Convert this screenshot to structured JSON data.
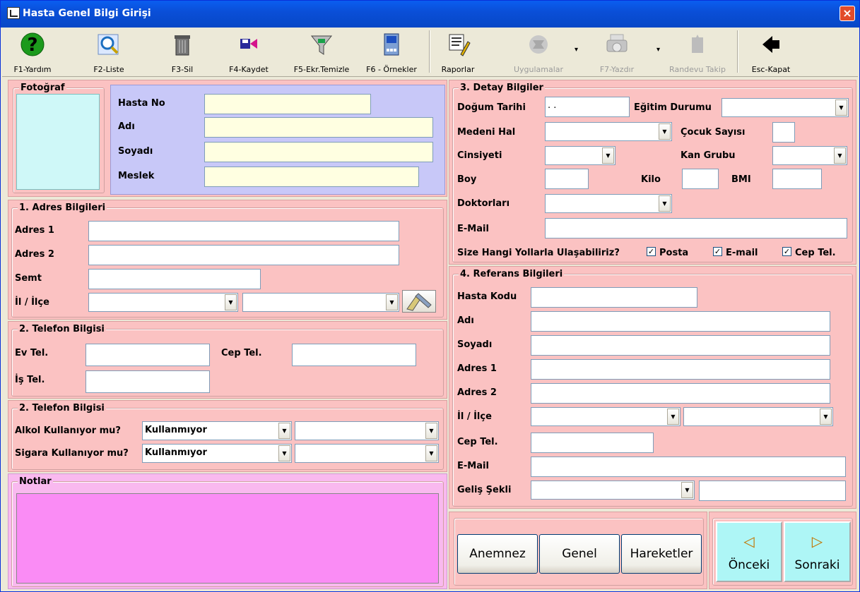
{
  "window": {
    "title": "Hasta Genel Bilgi Girişi",
    "close": "×"
  },
  "toolbar": {
    "help": "F1-Yardım",
    "list": "F2-Liste",
    "delete": "F3-Sil",
    "save": "F4-Kaydet",
    "clear": "F5-Ekr.Temizle",
    "examples": "F6 - Örnekler",
    "reports": "Raporlar",
    "apps": "Uygulamalar",
    "print": "F7-Yazdır",
    "appointment": "Randevu Takip",
    "close": "Esc-Kapat"
  },
  "photo": {
    "title": "Fotoğraf"
  },
  "patient": {
    "no_label": "Hasta No",
    "name_label": "Adı",
    "surname_label": "Soyadı",
    "job_label": "Meslek"
  },
  "address": {
    "title": "1. Adres Bilgileri",
    "addr1_label": "Adres 1",
    "addr2_label": "Adres 2",
    "district_label": "Semt",
    "city_label": "İl / İlçe"
  },
  "phone": {
    "title": "2. Telefon Bilgisi",
    "home_label": "Ev Tel.",
    "mobile_label": "Cep Tel.",
    "work_label": "İş Tel."
  },
  "habits": {
    "title": "2. Telefon Bilgisi",
    "alcohol_label": "Alkol Kullanıyor mu?",
    "alcohol_value": "Kullanmıyor",
    "smoking_label": "Sigara Kullanıyor mu?",
    "smoking_value": "Kullanmıyor"
  },
  "notes": {
    "title": "Notlar"
  },
  "details": {
    "title": "3. Detay Bilgiler",
    "birth_label": "Doğum Tarihi",
    "birth_value": " . .",
    "education_label": "Eğitim Durumu",
    "marital_label": "Medeni Hal",
    "children_label": "Çocuk Sayısı",
    "gender_label": "Cinsiyeti",
    "blood_label": "Kan Grubu",
    "height_label": "Boy",
    "weight_label": "Kilo",
    "bmi_label": "BMI",
    "doctors_label": "Doktorları",
    "email_label": "E-Mail",
    "contact_label": "Size Hangi Yollarla Ulaşabiliriz?",
    "contact_post": "Posta",
    "contact_email": "E-mail",
    "contact_mobile": "Cep Tel."
  },
  "reference": {
    "title": "4. Referans Bilgileri",
    "code_label": "Hasta Kodu",
    "name_label": "Adı",
    "surname_label": "Soyadı",
    "addr1_label": "Adres 1",
    "addr2_label": "Adres 2",
    "city_label": "İl / İlçe",
    "mobile_label": "Cep Tel.",
    "email_label": "E-Mail",
    "arrival_label": "Geliş Şekli"
  },
  "buttons": {
    "anamnesis": "Anemnez",
    "general": "Genel",
    "movements": "Hareketler",
    "prev": "Önceki",
    "next": "Sonraki",
    "prev_glyph": "◁",
    "next_glyph": "▷"
  },
  "colors": {
    "panel_pink": "#fbc2c2",
    "patient_lavender": "#c8c8f8",
    "photo_cyan": "#cff8f8",
    "notes_magenta": "#fa8cf5",
    "nav_cyan": "#aef6f6"
  }
}
